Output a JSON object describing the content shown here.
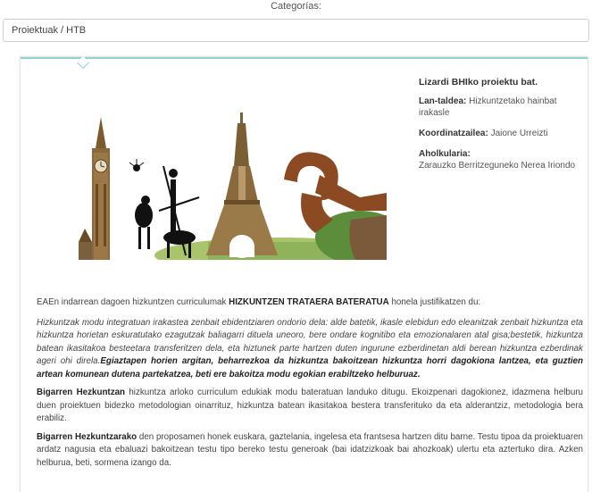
{
  "header": {
    "category_label": "Categorías:",
    "selected_category": "Proiektuak / HTB"
  },
  "info": {
    "title": "Lizardi BHIko proiektu bat.",
    "team_label": "Lan-taldea:",
    "team_value": "Hizkuntzetako hainbat irakasle",
    "coordinator_label": "Koordinatzailea:",
    "coordinator_value": "Jaione Urreizti",
    "advisor_label": "Aholkularia:",
    "advisor_value": "Zarauzko Berritzeguneko Nerea Iriondo"
  },
  "body": {
    "intro_prefix": "EAEn indarrean dagoen hizkuntzen curriculumak",
    "intro_bold": "HIZKUNTZEN TRATAERA BATERATUA",
    "intro_suffix": "honela justifikatzen du:",
    "quote_italic": "Hizkuntzak modu integratuan irakastea zenbait ebidentziaren ondorio dela: alde batetik, ikasle elebidun edo eleanitzak zenbait hizkuntza eta hizkuntza horietan eskuratutako ezagutzak baliagarri dituela uneoro, bere ondare kognitibo eta emozionalaren atal gisa;bestetik, hizkuntza batean ikasitakoa besteetara transferitzen dela, eta hiztunek parte hartzen duten ingurune ezberdinetan aldi berean hizkuntza ezberdinak ageri ohi direla.",
    "quote_bold_italic": "Egiaztapen horien argitan, beharrezkoa da hizkuntza bakoitzean hizkuntza horri dagokiona lantzea, eta guztien artean komunean dutena partekatzea, beti ere bakoitza modu egokian erabiltzeko helburuaz.",
    "p1_bold": "Bigarren Hezkuntzan",
    "p1_text": "hizkuntza arloko curriculum edukiak modu bateratuan landuko ditugu. Ekoizpenari dagokionez, idazmena helburu duen proiektuen bidezko metodologian oinarrituz, hizkuntza batean ikasitakoa bestera transferituko da eta alderantziz, metodologia bera erabiliz.",
    "p2_bold": "Bigarren Hezkuntzarako",
    "p2_text": "den proposamen honek euskara, gaztelania, ingelesa eta frantsesa hartzen ditu barne. Testu tipoa da proiektuaren ardatz nagusia eta ebaluazi bakoitzean testu tipo bereko testu generoak (bai idatzizkoak bai ahozkoak) ulertu eta aztertuko dira. Azken helburua, beti, sormena izango da."
  },
  "colors": {
    "accent_line": "#8fd3cf",
    "sky": "#ffffff",
    "rust": "#8b4a22",
    "tower": "#8a6a3c"
  },
  "icons": {
    "hero": "collage-image"
  }
}
